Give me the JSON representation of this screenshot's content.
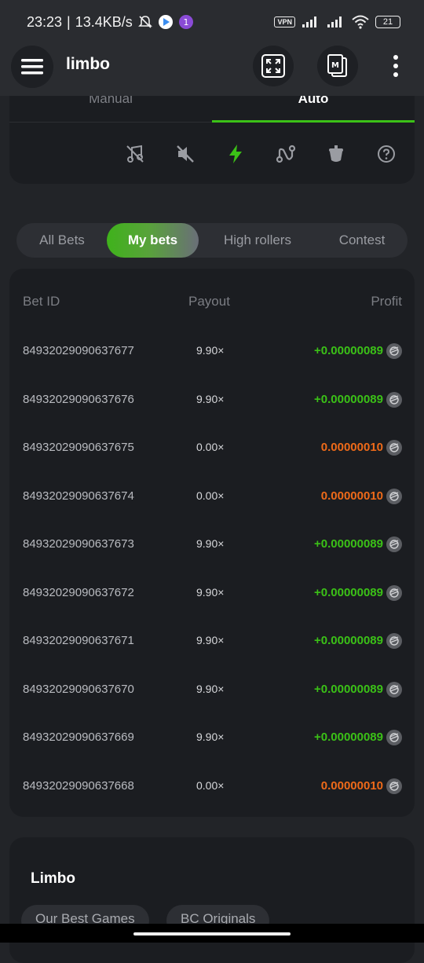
{
  "status": {
    "time": "23:23",
    "speed": "13.4KB/s",
    "vpn": "VPN",
    "battery": "21"
  },
  "header": {
    "title": "limbo"
  },
  "modes": {
    "manual": "Manual",
    "auto": "Auto"
  },
  "toolbar_icons": [
    "music-off-icon",
    "sound-off-icon",
    "lightning-icon",
    "route-icon",
    "hotkeys-icon",
    "help-icon"
  ],
  "bet_tabs": [
    "All Bets",
    "My bets",
    "High rollers",
    "Contest"
  ],
  "table": {
    "headers": {
      "id": "Bet ID",
      "payout": "Payout",
      "profit": "Profit"
    },
    "rows": [
      {
        "id": "84932029090637677",
        "payout": "9.90×",
        "profit": "+0.00000089",
        "result": "win"
      },
      {
        "id": "84932029090637676",
        "payout": "9.90×",
        "profit": "+0.00000089",
        "result": "win"
      },
      {
        "id": "84932029090637675",
        "payout": "0.00×",
        "profit": "0.00000010",
        "result": "loss"
      },
      {
        "id": "84932029090637674",
        "payout": "0.00×",
        "profit": "0.00000010",
        "result": "loss"
      },
      {
        "id": "84932029090637673",
        "payout": "9.90×",
        "profit": "+0.00000089",
        "result": "win"
      },
      {
        "id": "84932029090637672",
        "payout": "9.90×",
        "profit": "+0.00000089",
        "result": "win"
      },
      {
        "id": "84932029090637671",
        "payout": "9.90×",
        "profit": "+0.00000089",
        "result": "win"
      },
      {
        "id": "84932029090637670",
        "payout": "9.90×",
        "profit": "+0.00000089",
        "result": "win"
      },
      {
        "id": "84932029090637669",
        "payout": "9.90×",
        "profit": "+0.00000089",
        "result": "win"
      },
      {
        "id": "84932029090637668",
        "payout": "0.00×",
        "profit": "0.00000010",
        "result": "loss"
      }
    ]
  },
  "game_info": {
    "title": "Limbo",
    "chips": [
      "Our Best Games",
      "BC Originals"
    ]
  },
  "colors": {
    "accent": "#3bc117",
    "loss": "#ee6a19",
    "bg": "#222428",
    "card": "#1b1d21"
  }
}
